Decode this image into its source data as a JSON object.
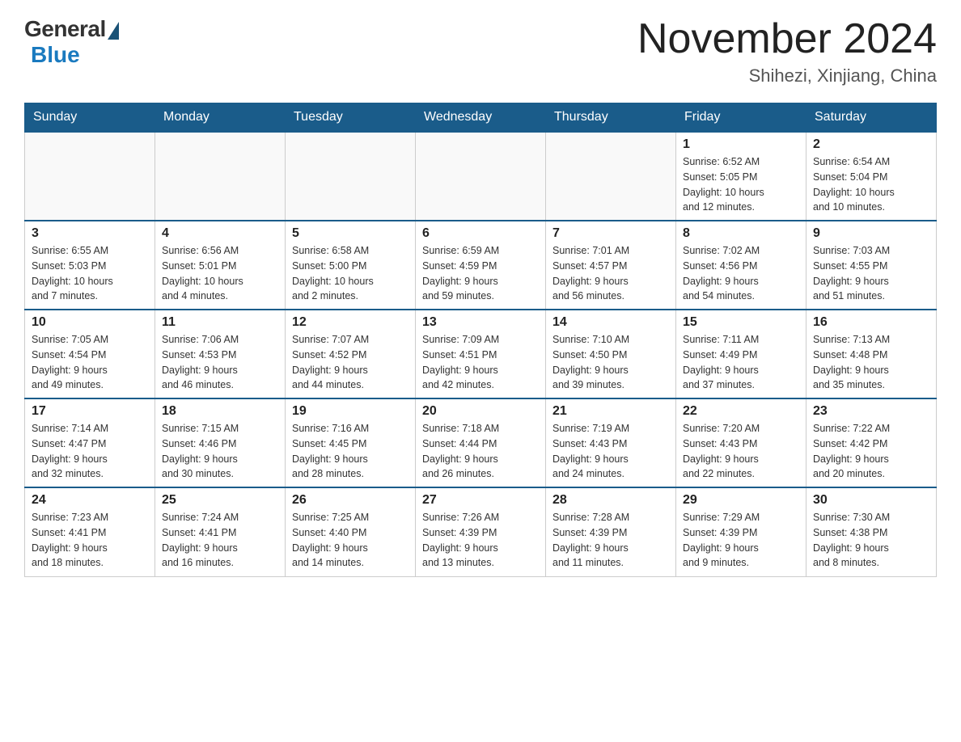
{
  "header": {
    "logo_general": "General",
    "logo_blue": "Blue",
    "title": "November 2024",
    "subtitle": "Shihezi, Xinjiang, China"
  },
  "weekdays": [
    "Sunday",
    "Monday",
    "Tuesday",
    "Wednesday",
    "Thursday",
    "Friday",
    "Saturday"
  ],
  "weeks": [
    [
      {
        "day": "",
        "info": ""
      },
      {
        "day": "",
        "info": ""
      },
      {
        "day": "",
        "info": ""
      },
      {
        "day": "",
        "info": ""
      },
      {
        "day": "",
        "info": ""
      },
      {
        "day": "1",
        "info": "Sunrise: 6:52 AM\nSunset: 5:05 PM\nDaylight: 10 hours\nand 12 minutes."
      },
      {
        "day": "2",
        "info": "Sunrise: 6:54 AM\nSunset: 5:04 PM\nDaylight: 10 hours\nand 10 minutes."
      }
    ],
    [
      {
        "day": "3",
        "info": "Sunrise: 6:55 AM\nSunset: 5:03 PM\nDaylight: 10 hours\nand 7 minutes."
      },
      {
        "day": "4",
        "info": "Sunrise: 6:56 AM\nSunset: 5:01 PM\nDaylight: 10 hours\nand 4 minutes."
      },
      {
        "day": "5",
        "info": "Sunrise: 6:58 AM\nSunset: 5:00 PM\nDaylight: 10 hours\nand 2 minutes."
      },
      {
        "day": "6",
        "info": "Sunrise: 6:59 AM\nSunset: 4:59 PM\nDaylight: 9 hours\nand 59 minutes."
      },
      {
        "day": "7",
        "info": "Sunrise: 7:01 AM\nSunset: 4:57 PM\nDaylight: 9 hours\nand 56 minutes."
      },
      {
        "day": "8",
        "info": "Sunrise: 7:02 AM\nSunset: 4:56 PM\nDaylight: 9 hours\nand 54 minutes."
      },
      {
        "day": "9",
        "info": "Sunrise: 7:03 AM\nSunset: 4:55 PM\nDaylight: 9 hours\nand 51 minutes."
      }
    ],
    [
      {
        "day": "10",
        "info": "Sunrise: 7:05 AM\nSunset: 4:54 PM\nDaylight: 9 hours\nand 49 minutes."
      },
      {
        "day": "11",
        "info": "Sunrise: 7:06 AM\nSunset: 4:53 PM\nDaylight: 9 hours\nand 46 minutes."
      },
      {
        "day": "12",
        "info": "Sunrise: 7:07 AM\nSunset: 4:52 PM\nDaylight: 9 hours\nand 44 minutes."
      },
      {
        "day": "13",
        "info": "Sunrise: 7:09 AM\nSunset: 4:51 PM\nDaylight: 9 hours\nand 42 minutes."
      },
      {
        "day": "14",
        "info": "Sunrise: 7:10 AM\nSunset: 4:50 PM\nDaylight: 9 hours\nand 39 minutes."
      },
      {
        "day": "15",
        "info": "Sunrise: 7:11 AM\nSunset: 4:49 PM\nDaylight: 9 hours\nand 37 minutes."
      },
      {
        "day": "16",
        "info": "Sunrise: 7:13 AM\nSunset: 4:48 PM\nDaylight: 9 hours\nand 35 minutes."
      }
    ],
    [
      {
        "day": "17",
        "info": "Sunrise: 7:14 AM\nSunset: 4:47 PM\nDaylight: 9 hours\nand 32 minutes."
      },
      {
        "day": "18",
        "info": "Sunrise: 7:15 AM\nSunset: 4:46 PM\nDaylight: 9 hours\nand 30 minutes."
      },
      {
        "day": "19",
        "info": "Sunrise: 7:16 AM\nSunset: 4:45 PM\nDaylight: 9 hours\nand 28 minutes."
      },
      {
        "day": "20",
        "info": "Sunrise: 7:18 AM\nSunset: 4:44 PM\nDaylight: 9 hours\nand 26 minutes."
      },
      {
        "day": "21",
        "info": "Sunrise: 7:19 AM\nSunset: 4:43 PM\nDaylight: 9 hours\nand 24 minutes."
      },
      {
        "day": "22",
        "info": "Sunrise: 7:20 AM\nSunset: 4:43 PM\nDaylight: 9 hours\nand 22 minutes."
      },
      {
        "day": "23",
        "info": "Sunrise: 7:22 AM\nSunset: 4:42 PM\nDaylight: 9 hours\nand 20 minutes."
      }
    ],
    [
      {
        "day": "24",
        "info": "Sunrise: 7:23 AM\nSunset: 4:41 PM\nDaylight: 9 hours\nand 18 minutes."
      },
      {
        "day": "25",
        "info": "Sunrise: 7:24 AM\nSunset: 4:41 PM\nDaylight: 9 hours\nand 16 minutes."
      },
      {
        "day": "26",
        "info": "Sunrise: 7:25 AM\nSunset: 4:40 PM\nDaylight: 9 hours\nand 14 minutes."
      },
      {
        "day": "27",
        "info": "Sunrise: 7:26 AM\nSunset: 4:39 PM\nDaylight: 9 hours\nand 13 minutes."
      },
      {
        "day": "28",
        "info": "Sunrise: 7:28 AM\nSunset: 4:39 PM\nDaylight: 9 hours\nand 11 minutes."
      },
      {
        "day": "29",
        "info": "Sunrise: 7:29 AM\nSunset: 4:39 PM\nDaylight: 9 hours\nand 9 minutes."
      },
      {
        "day": "30",
        "info": "Sunrise: 7:30 AM\nSunset: 4:38 PM\nDaylight: 9 hours\nand 8 minutes."
      }
    ]
  ]
}
